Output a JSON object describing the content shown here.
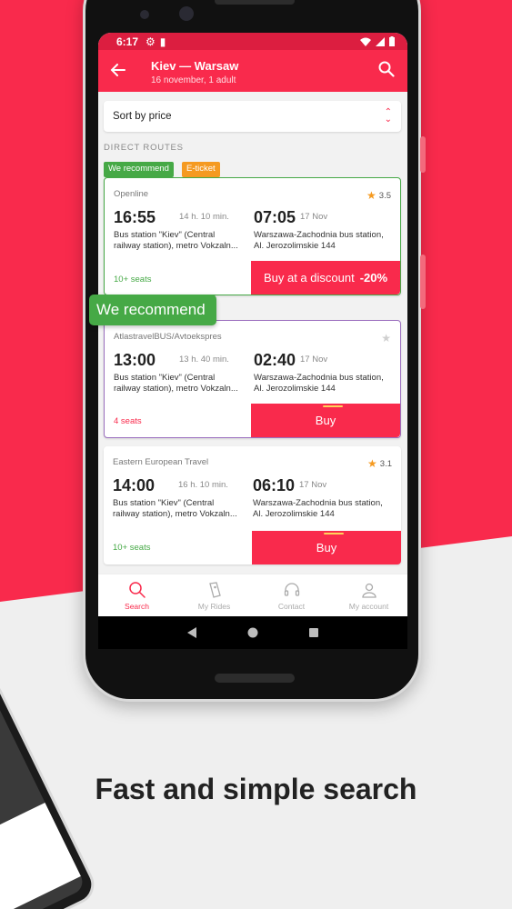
{
  "colors": {
    "brand": "#f92a4c",
    "statusbar": "#dc1e40",
    "recommend": "#46a946",
    "eticket": "#f59a21",
    "page_bg": "#efefef"
  },
  "status_bar": {
    "time": "6:17"
  },
  "app_bar": {
    "title": "Kiev — Warsaw",
    "subtitle": "16 november, 1 adult",
    "back_icon": "arrow-left-icon",
    "search_icon": "search-icon"
  },
  "sort": {
    "label": "Sort by price"
  },
  "section": {
    "label": "DIRECT ROUTES"
  },
  "badges": {
    "recommend": "We recommend",
    "eticket": "E-ticket"
  },
  "tooltip": {
    "label": "We recommend"
  },
  "trips": [
    {
      "operator": "Openline",
      "rating": "3.5",
      "departure": "16:55",
      "duration": "14 h. 10 min.",
      "arrival": "07:05",
      "arrival_date": "17 Nov",
      "from": "Bus station \"Kiev\" (Central\nrailway station), metro Vokzaln...",
      "to": "Warszawa-Zachodnia bus station,\nAl. Jerozolimskie 144",
      "seats": "10+ seats",
      "button": "Buy at a discount",
      "discount": "-20%"
    },
    {
      "operator": "AtlastravelBUS/Avtoekspres",
      "rating": "",
      "departure": "13:00",
      "duration": "13 h. 40 min.",
      "arrival": "02:40",
      "arrival_date": "17 Nov",
      "from": "Bus station \"Kiev\" (Central\nrailway station), metro Vokzaln...",
      "to": "Warszawa-Zachodnia bus station,\nAl. Jerozolimskie 144",
      "seats": "4 seats",
      "button": "Buy",
      "discount": ""
    },
    {
      "operator": "Eastern European Travel",
      "rating": "3.1",
      "departure": "14:00",
      "duration": "16 h. 10 min.",
      "arrival": "06:10",
      "arrival_date": "17 Nov",
      "from": "Bus station \"Kiev\" (Central\nrailway station), metro Vokzaln...",
      "to": "Warszawa-Zachodnia bus station,\nAl. Jerozolimskie 144",
      "seats": "10+ seats",
      "button": "Buy",
      "discount": ""
    }
  ],
  "bottom_nav": [
    {
      "label": "Search",
      "icon": "search-icon"
    },
    {
      "label": "My Rides",
      "icon": "ticket-icon"
    },
    {
      "label": "Contact",
      "icon": "headset-icon"
    },
    {
      "label": "My account",
      "icon": "user-icon"
    }
  ],
  "headline": "Fast and simple search"
}
